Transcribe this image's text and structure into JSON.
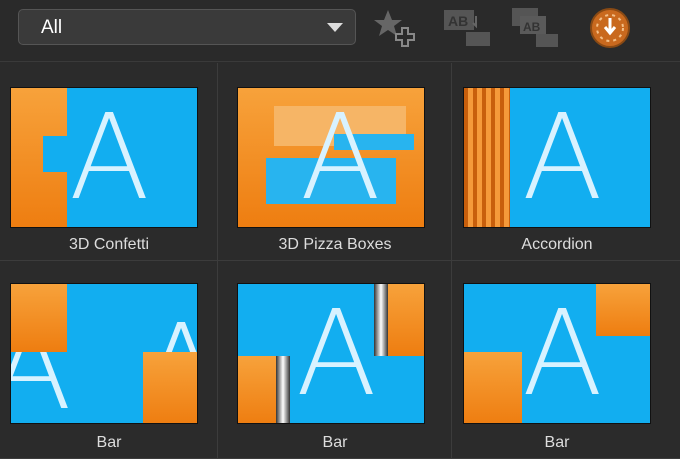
{
  "toolbar": {
    "filter_value": "All",
    "tools": [
      "add-favorite-icon",
      "apply-to-selected-icon",
      "apply-to-all-icon",
      "download-transitions-icon"
    ]
  },
  "transitions": [
    {
      "label": "3D Confetti"
    },
    {
      "label": "3D Pizza Boxes"
    },
    {
      "label": "Accordion"
    },
    {
      "label": "Bar"
    },
    {
      "label": "Bar"
    },
    {
      "label": "Bar"
    }
  ],
  "thumb_letter": "A",
  "colors": {
    "blue": "#12aef0",
    "orange": "#ee7d10",
    "background": "#2b2b2b"
  }
}
